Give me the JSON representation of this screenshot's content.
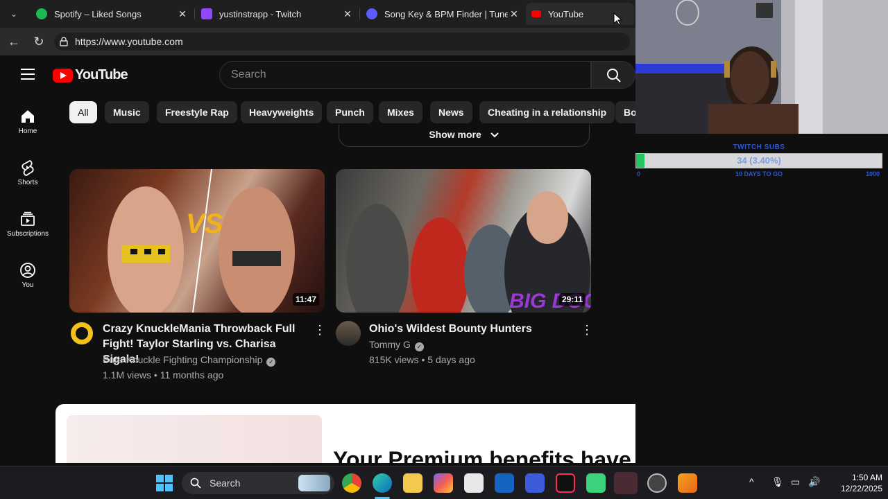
{
  "browser": {
    "tabs": [
      {
        "title": "Spotify – Liked Songs",
        "favicon_color": "#1db954",
        "active": false
      },
      {
        "title": "yustinstrapp - Twitch",
        "favicon_color": "#9146ff",
        "active": false
      },
      {
        "title": "Song Key & BPM Finder | Tunebat",
        "favicon_color": "#5b5bff",
        "active": false
      },
      {
        "title": "YouTube",
        "favicon_color": "#ff0000",
        "active": true
      }
    ],
    "url": "https://www.youtube.com"
  },
  "youtube": {
    "logo_text": "YouTube",
    "search_placeholder": "Search",
    "sidebar": [
      {
        "label": "Home",
        "icon": "home-icon"
      },
      {
        "label": "Shorts",
        "icon": "shorts-icon"
      },
      {
        "label": "Subscriptions",
        "icon": "subscriptions-icon"
      },
      {
        "label": "You",
        "icon": "you-icon"
      }
    ],
    "chips": [
      "All",
      "Music",
      "Freestyle Rap",
      "Heavyweights",
      "Punch",
      "Mixes",
      "News",
      "Cheating in a relationship",
      "Bo"
    ],
    "show_more": "Show more",
    "videos": [
      {
        "title": "Crazy KnuckleMania Throwback Full Fight! Taylor Starling vs. Charisa Sigala!",
        "channel": "Bare Knuckle Fighting Championship",
        "meta": "1.1M views • 11 months ago",
        "duration": "11:47",
        "verified": true
      },
      {
        "title": "Ohio's Wildest Bounty Hunters",
        "channel": "Tommy G",
        "meta": "815K views • 5 days ago",
        "duration": "29:11",
        "verified": true
      }
    ],
    "premium_banner": "Your Premium benefits have just ended"
  },
  "overlay": {
    "subs_title": "TWITCH SUBS",
    "subs_value": "34 (3.40%)",
    "subs_progress": 0.034,
    "subs_min": "0",
    "subs_days": "10 DAYS TO GO",
    "subs_max": "1000"
  },
  "taskbar": {
    "search_label": "Search",
    "time": "1:50 AM",
    "date": "12/22/2025"
  },
  "colors": {
    "youtube_red": "#ff0000",
    "subs_green": "#22c55e",
    "subs_blue": "#2a56d6"
  }
}
